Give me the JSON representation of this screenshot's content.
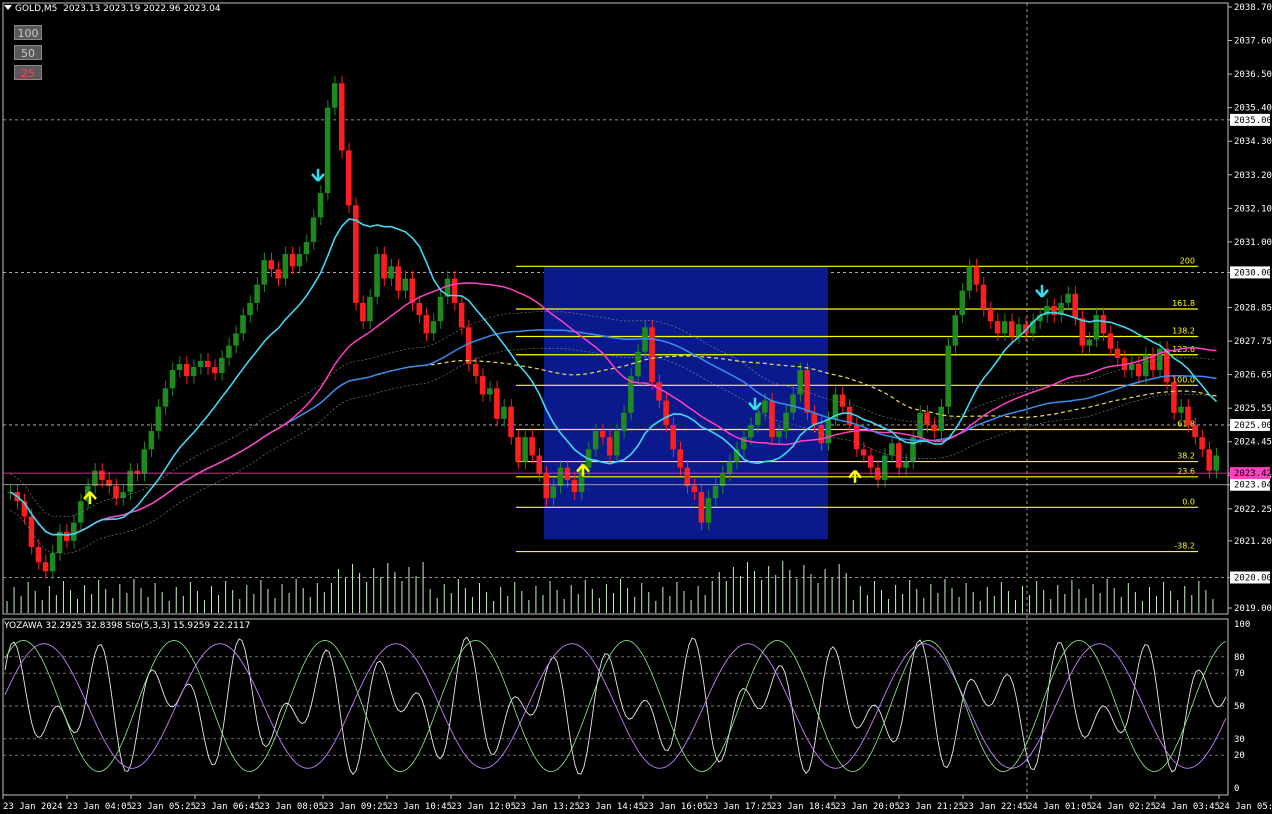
{
  "header": {
    "symbol": "GOLD,M5",
    "ohlc": "2023.13 2023.19 2022.96 2023.04"
  },
  "level_buttons": [
    {
      "label": "100",
      "color": "#c8c8c8"
    },
    {
      "label": "50",
      "color": "#c8c8c8"
    },
    {
      "label": "25",
      "color": "#ff4040"
    }
  ],
  "subwindow": {
    "label": "YOZAWA 32.2925 32.8398  Sto(5,3,3) 15.9259 22.2117"
  },
  "colors": {
    "bull": "#1e8a1e",
    "bear": "#ff1e1e",
    "cyan_ma": "#40d8f0",
    "blue_ma": "#3a8cf0",
    "magenta_ma": "#ff40c0",
    "yellow_ma": "#e8e05a",
    "fib": "#ffff00",
    "box": "#0a1a8c",
    "volume": "#c8f0c8"
  },
  "chart_data": {
    "type": "candlestick",
    "price_axis": {
      "labels": [
        "2038.70",
        "2037.60",
        "2036.50",
        "2035.40",
        "2035.00",
        "2034.30",
        "2033.20",
        "2032.10",
        "2031.00",
        "2030.00",
        "2028.85",
        "2027.75",
        "2026.65",
        "2025.55",
        "2025.00",
        "2024.45",
        "2023.35",
        "2023.04",
        "2022.25",
        "2021.20",
        "2020.00",
        "2019.00"
      ],
      "highlighted": [
        {
          "label": "2035.00",
          "bg": "#ffffff",
          "fg": "#000000"
        },
        {
          "label": "2030.00",
          "bg": "#ffffff",
          "fg": "#000000"
        },
        {
          "label": "2025.00",
          "bg": "#ffffff",
          "fg": "#000000"
        },
        {
          "label": "2023.42",
          "bg": "#ff40c0",
          "fg": "#000000"
        },
        {
          "label": "2023.04",
          "bg": "#ffffff",
          "fg": "#000000"
        },
        {
          "label": "2020.00",
          "bg": "#ffffff",
          "fg": "#000000"
        }
      ],
      "range": [
        2019.0,
        2038.7
      ]
    },
    "time_axis": [
      "23 Jan 2024",
      "23 Jan 04:05",
      "23 Jan 05:25",
      "23 Jan 06:45",
      "23 Jan 08:05",
      "23 Jan 09:25",
      "23 Jan 10:45",
      "23 Jan 12:05",
      "23 Jan 13:25",
      "23 Jan 14:45",
      "23 Jan 16:05",
      "23 Jan 17:25",
      "23 Jan 18:45",
      "23 Jan 20:05",
      "23 Jan 21:25",
      "23 Jan 22:45",
      "24 Jan 01:05",
      "24 Jan 02:25",
      "24 Jan 03:45",
      "24 Jan 05:05"
    ],
    "fib_levels": [
      "200",
      "161.8",
      "138.2",
      "123.6",
      "100.0",
      "61.8",
      "38.2",
      "23.6",
      "0.0",
      "-38.2"
    ],
    "fib_prices": [
      2030.2,
      2028.8,
      2027.9,
      2027.3,
      2026.3,
      2024.85,
      2023.8,
      2023.3,
      2022.3,
      2020.85
    ],
    "sub_axis": [
      "100",
      "80",
      "70",
      "50",
      "30",
      "20",
      "0"
    ],
    "closes": [
      2022.8,
      2022.5,
      2022.0,
      2021.0,
      2020.5,
      2020.2,
      2020.8,
      2021.5,
      2021.2,
      2021.8,
      2022.5,
      2023.0,
      2023.5,
      2023.2,
      2023.0,
      2022.6,
      2022.8,
      2023.5,
      2023.4,
      2024.2,
      2024.8,
      2025.6,
      2026.2,
      2026.8,
      2027.0,
      2026.6,
      2026.9,
      2027.1,
      2026.9,
      2026.7,
      2027.2,
      2027.6,
      2028.0,
      2028.6,
      2029.0,
      2029.6,
      2030.4,
      2030.1,
      2029.8,
      2030.6,
      2030.2,
      2030.6,
      2031.0,
      2031.8,
      2032.6,
      2035.4,
      2036.2,
      2034.0,
      2032.2,
      2029.0,
      2028.4,
      2029.2,
      2030.6,
      2029.8,
      2030.2,
      2029.4,
      2029.8,
      2029.0,
      2028.6,
      2028.0,
      2028.4,
      2029.2,
      2029.8,
      2029.0,
      2028.2,
      2027.0,
      2026.6,
      2026.0,
      2026.2,
      2025.2,
      2025.6,
      2024.6,
      2023.8,
      2024.6,
      2024.0,
      2023.4,
      2022.6,
      2023.0,
      2023.6,
      2023.2,
      2022.8,
      2023.6,
      2024.2,
      2024.8,
      2024.6,
      2024.0,
      2024.8,
      2025.4,
      2026.6,
      2027.4,
      2028.2,
      2026.4,
      2025.8,
      2025.0,
      2024.2,
      2023.6,
      2023.0,
      2022.8,
      2021.8,
      2022.6,
      2023.0,
      2023.4,
      2023.8,
      2024.2,
      2024.6,
      2025.0,
      2025.4,
      2025.8,
      2024.6,
      2024.8,
      2025.4,
      2026.0,
      2026.8,
      2025.4,
      2025.0,
      2024.4,
      2025.2,
      2026.0,
      2025.6,
      2025.0,
      2024.2,
      2024.0,
      2023.6,
      2023.2,
      2024.0,
      2024.4,
      2023.6,
      2023.8,
      2024.6,
      2025.4,
      2025.0,
      2024.8,
      2025.6,
      2027.6,
      2028.6,
      2029.4,
      2030.2,
      2029.6,
      2028.8,
      2028.4,
      2028.0,
      2028.4,
      2027.9,
      2028.3,
      2028.0,
      2028.4,
      2028.6,
      2028.9,
      2028.6,
      2029.0,
      2029.3,
      2028.5,
      2027.6,
      2027.8,
      2028.6,
      2028.0,
      2027.5,
      2027.2,
      2026.8,
      2027.0,
      2026.6,
      2027.3,
      2026.8,
      2027.5,
      2026.4,
      2025.4,
      2025.6,
      2025.0,
      2024.6,
      2024.2,
      2023.5,
      2024.0
    ]
  }
}
